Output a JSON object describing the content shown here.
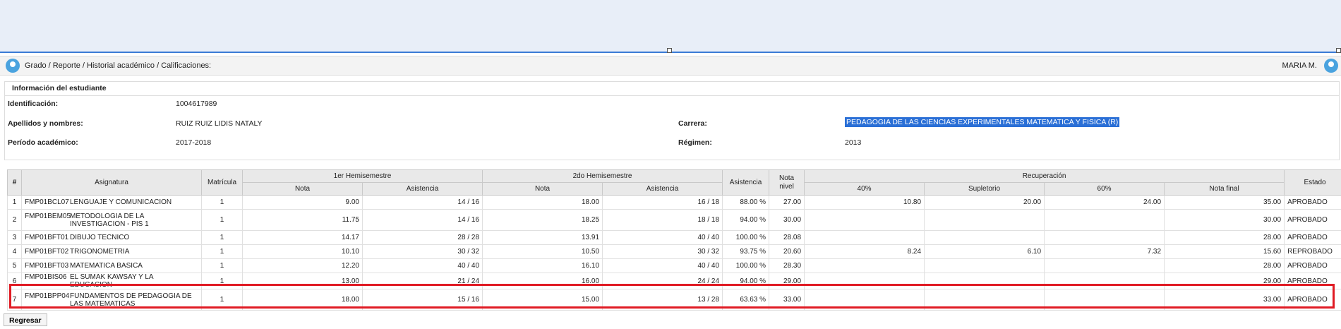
{
  "breadcrumb": "Grado / Reporte / Historial académico / Calificaciones:",
  "user": {
    "name": "MARIA M."
  },
  "student": {
    "section_title": "Información del estudiante",
    "id_label": "Identificación:",
    "id_value": "1004617989",
    "name_label": "Apellidos y nombres:",
    "name_value": "RUIZ RUIZ LIDIS NATALY",
    "period_label": "Período académico:",
    "period_value": "2017-2018",
    "career_label": "Carrera:",
    "career_value": "PEDAGOGIA DE LAS CIENCIAS EXPERIMENTALES MATEMATICA Y FISICA (R)",
    "regime_label": "Régimen:",
    "regime_value": "2013"
  },
  "table": {
    "headers": {
      "num": "#",
      "subject": "Asignatura",
      "enrollment": "Matrícula",
      "h1": "1er Hemisemestre",
      "h2": "2do Hemisemestre",
      "attendance": "Asistencia",
      "level_grade": "Nota nivel",
      "recovery": "Recuperación",
      "status": "Estado",
      "grade": "Nota",
      "att": "Asistencia",
      "p40": "40%",
      "supletorio": "Supletorio",
      "p60": "60%",
      "final": "Nota final"
    },
    "rows": [
      {
        "num": "1",
        "code": "FMP01BCL07",
        "name": "LENGUAJE Y COMUNICACION",
        "mat": "1",
        "n1": "9.00",
        "a1": "14 / 16",
        "n2": "18.00",
        "a2": "16 / 18",
        "att": "88.00 %",
        "nivel": "27.00",
        "r40": "10.80",
        "sup": "20.00",
        "r60": "24.00",
        "final": "35.00",
        "estado": "APROBADO"
      },
      {
        "num": "2",
        "code": "FMP01BEM05",
        "name": "METODOLOGIA DE LA INVESTIGACION - PIS 1",
        "mat": "1",
        "n1": "11.75",
        "a1": "14 / 16",
        "n2": "18.25",
        "a2": "18 / 18",
        "att": "94.00 %",
        "nivel": "30.00",
        "r40": "",
        "sup": "",
        "r60": "",
        "final": "30.00",
        "estado": "APROBADO"
      },
      {
        "num": "3",
        "code": "FMP01BFT01",
        "name": "DIBUJO TECNICO",
        "mat": "1",
        "n1": "14.17",
        "a1": "28 / 28",
        "n2": "13.91",
        "a2": "40 / 40",
        "att": "100.00 %",
        "nivel": "28.08",
        "r40": "",
        "sup": "",
        "r60": "",
        "final": "28.00",
        "estado": "APROBADO"
      },
      {
        "num": "4",
        "code": "FMP01BFT02",
        "name": "TRIGONOMETRIA",
        "mat": "1",
        "n1": "10.10",
        "a1": "30 / 32",
        "n2": "10.50",
        "a2": "30 / 32",
        "att": "93.75 %",
        "nivel": "20.60",
        "r40": "8.24",
        "sup": "6.10",
        "r60": "7.32",
        "final": "15.60",
        "estado": "REPROBADO"
      },
      {
        "num": "5",
        "code": "FMP01BFT03",
        "name": "MATEMATICA BASICA",
        "mat": "1",
        "n1": "12.20",
        "a1": "40 / 40",
        "n2": "16.10",
        "a2": "40 / 40",
        "att": "100.00 %",
        "nivel": "28.30",
        "r40": "",
        "sup": "",
        "r60": "",
        "final": "28.00",
        "estado": "APROBADO"
      },
      {
        "num": "6",
        "code": "FMP01BIS06",
        "name": "EL SUMAK KAWSAY Y LA EDUCACION",
        "mat": "1",
        "n1": "13.00",
        "a1": "21 / 24",
        "n2": "16.00",
        "a2": "24 / 24",
        "att": "94.00 %",
        "nivel": "29.00",
        "r40": "",
        "sup": "",
        "r60": "",
        "final": "29.00",
        "estado": "APROBADO"
      },
      {
        "num": "7",
        "code": "FMP01BPP04",
        "name": "FUNDAMENTOS DE PEDAGOGIA DE LAS MATEMATICAS",
        "mat": "1",
        "n1": "18.00",
        "a1": "15 / 16",
        "n2": "15.00",
        "a2": "13 / 28",
        "att": "63.63 %",
        "nivel": "33.00",
        "r40": "",
        "sup": "",
        "r60": "",
        "final": "33.00",
        "estado": "APROBADO"
      }
    ]
  },
  "back_button": "Regresar"
}
